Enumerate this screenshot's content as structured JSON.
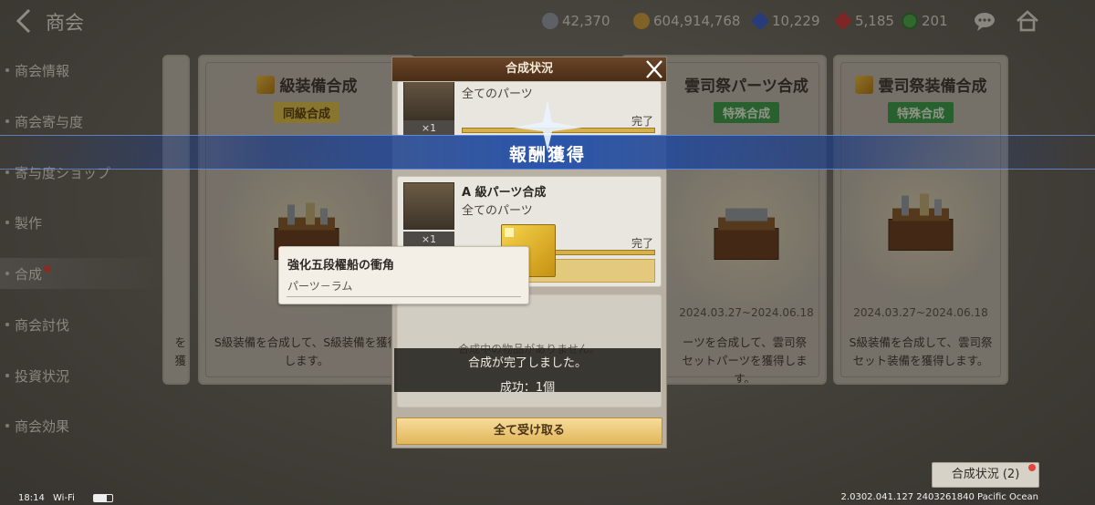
{
  "header": {
    "title": "商会",
    "resources": [
      {
        "icon": "silver-coin-icon",
        "value": "42,370",
        "color": "#9aa3ad"
      },
      {
        "icon": "gold-coin-icon",
        "value": "604,914,768",
        "color": "#d9a23b"
      },
      {
        "icon": "blue-gem-icon",
        "value": "10,229",
        "color": "#3a5fd8"
      },
      {
        "icon": "red-gem-icon",
        "value": "5,185",
        "color": "#d23a3a"
      },
      {
        "icon": "green-medal-icon",
        "value": "201",
        "color": "#4cae4c"
      }
    ]
  },
  "sidebar": {
    "items": [
      {
        "label": "商会情報"
      },
      {
        "label": "商会寄与度"
      },
      {
        "label": "寄与度ショップ"
      },
      {
        "label": "製作"
      },
      {
        "label": "合成"
      },
      {
        "label": "商会討伐"
      },
      {
        "label": "投資状況"
      },
      {
        "label": "商会効果"
      }
    ]
  },
  "cards": [
    {
      "title": "",
      "desc": "を獲"
    },
    {
      "title": "級装備合成",
      "badge": "同級合成",
      "desc": "S級装備を合成して、S級装備を獲得します。"
    },
    {
      "title": "雲司祭パーツ合成",
      "badge": "特殊合成",
      "date": "2024.03.27~2024.06.18",
      "desc": "ーツを合成して、雲司祭セットパーツを獲得します。"
    },
    {
      "title": "雲司祭装備合成",
      "badge": "特殊合成",
      "date": "2024.03.27~2024.06.18",
      "desc": "S級装備を合成して、雲司祭セット装備を獲得します。"
    }
  ],
  "dialog": {
    "title": "合成状況",
    "entries": [
      {
        "title": "",
        "sub": "全てのパーツ",
        "qty": "×1",
        "status": "完了"
      },
      {
        "title": "A 級パーツ合成",
        "sub": "全てのパーツ",
        "qty": "×1",
        "status": "完了"
      },
      {
        "empty_text": "合成中の物品がありません。"
      }
    ],
    "claim_all": "全て受け取る"
  },
  "reward_banner": "報酬獲得",
  "toast": {
    "line1": "合成が完了しました。",
    "line2": "成功：1個"
  },
  "tooltip": {
    "name": "強化五段櫂船の衝角",
    "type": "パーツ－ラム"
  },
  "status_button": "合成状況 (2)",
  "statusbar": {
    "time": "18:14",
    "wifi": "Wi-Fi",
    "version": "2.0302.041.127 2403261840 Pacific Ocean"
  }
}
